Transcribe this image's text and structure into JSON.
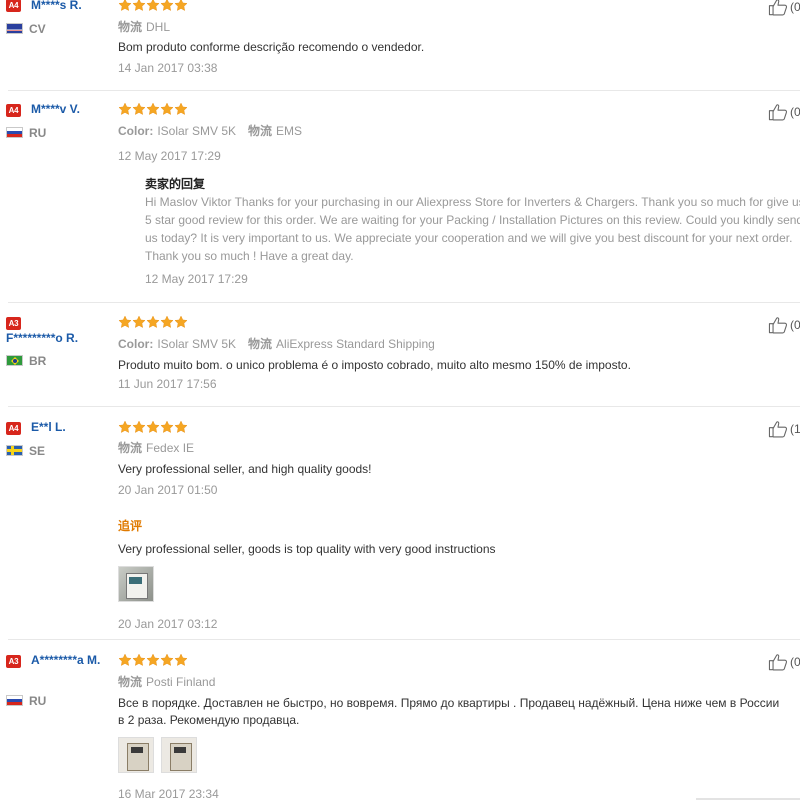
{
  "colors": {
    "accent_star": "#f5a623",
    "username": "#1b5aa8",
    "badge": "#d7261c",
    "followup": "#e07a00"
  },
  "labels": {
    "shipping_key": "物流",
    "color_key": "Color:",
    "seller_reply_title": "卖家的回复",
    "followup_title": "追评"
  },
  "reviews": [
    {
      "badge": "A4",
      "user": "M****s R.",
      "country": "CV",
      "flag": "cv-flag-icon",
      "stars": 5,
      "shipping": "DHL",
      "text": "Bom produto conforme descrição recomendo o vendedor.",
      "date": "14 Jan 2017 03:38",
      "likes": "(0"
    },
    {
      "badge": "A4",
      "user": "M****v V.",
      "country": "RU",
      "flag": "ru-flag-icon",
      "stars": 5,
      "color": "ISolar SMV 5K",
      "shipping": "EMS",
      "date": "12 May 2017 17:29",
      "reply": {
        "text": "Hi Maslov Viktor Thanks for your purchasing in our Aliexpress Store for Inverters & Chargers. Thank you so much for give us 5 star good review for this order. We are waiting for your Packing / Installation Pictures on this review. Could you kindly send us today? It is very important to us. We appreciate your cooperation and we will give you best discount for your next order. Thank you so much ! Have a great day.",
        "date": "12 May 2017 17:29"
      },
      "likes": "(0"
    },
    {
      "badge": "A3",
      "user": "F*********o R.",
      "country": "BR",
      "flag": "br-flag-icon",
      "stars": 5,
      "color": "ISolar SMV 5K",
      "shipping": "AliExpress Standard Shipping",
      "text": "Produto muito bom. o unico problema é o imposto cobrado, muito alto mesmo 150% de imposto.",
      "date": "11 Jun 2017 17:56",
      "likes": "(0"
    },
    {
      "badge": "A4",
      "user": "E**l L.",
      "country": "SE",
      "flag": "se-flag-icon",
      "stars": 5,
      "shipping": "Fedex IE",
      "text": "Very professional seller, and high quality goods!",
      "date": "20 Jan 2017 01:50",
      "followup": {
        "text": "Very professional seller, goods is top quality with very good instructions",
        "date": "20 Jan 2017 03:12"
      },
      "likes": "(1"
    },
    {
      "badge": "A3",
      "user": "A********a M.",
      "country": "RU",
      "flag": "ru-flag-icon",
      "stars": 5,
      "shipping": "Posti Finland",
      "text": "Все в порядке. Доставлен не быстро, но вовремя. Прямо до квартиры . Продавец надёжный. Цена ниже чем в России в 2 раза. Рекомендую продавца.",
      "date": "16 Mar 2017 23:34",
      "likes": "(0"
    }
  ]
}
